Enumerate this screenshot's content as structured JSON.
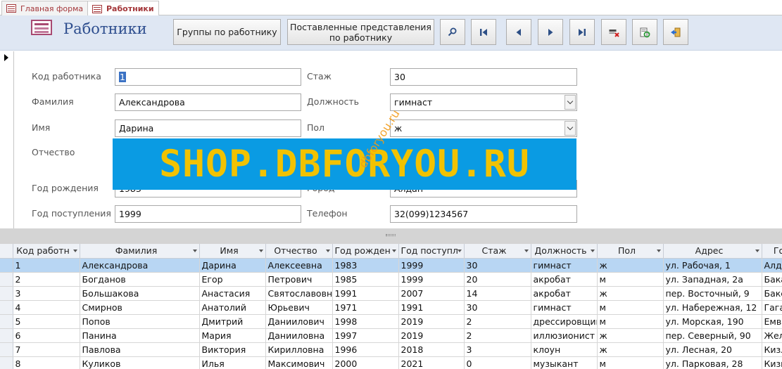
{
  "tabs": [
    {
      "label": "Главная форма",
      "active": false
    },
    {
      "label": "Работники",
      "active": true
    }
  ],
  "header": {
    "title": "Работники",
    "btn_groups": "Группы по работнику",
    "btn_performances_l1": "Поставленные представления",
    "btn_performances_l2": "по работнику"
  },
  "icons": {
    "search": "magnifier-icon",
    "first": "first-record-icon",
    "prev": "previous-record-icon",
    "next": "next-record-icon",
    "last": "last-record-icon",
    "delete": "delete-record-icon",
    "refresh": "refresh-icon",
    "exit": "exit-icon"
  },
  "form": {
    "code_label": "Код работника",
    "code_value": "1",
    "surname_label": "Фамилия",
    "surname_value": "Александрова",
    "name_label": "Имя",
    "name_value": "Дарина",
    "patronymic_label": "Отчество",
    "birth_label": "Год рождения",
    "birth_value": "1983",
    "hire_label": "Год поступления",
    "hire_value": "1999",
    "exp_label": "Стаж",
    "exp_value": "30",
    "position_label": "Должность",
    "position_value": "гимнаст",
    "sex_label": "Пол",
    "sex_value": "ж",
    "city_label": "Город",
    "city_value": "Алдан",
    "phone_label": "Телефон",
    "phone_value": "32(099)1234567"
  },
  "watermark": {
    "banner": "SHOP.DBFORYOU.RU",
    "diagonal": "dbforyou.ru"
  },
  "grid": {
    "columns": [
      "Код работн",
      "Фамилия",
      "Имя",
      "Отчество",
      "Год рожден",
      "Год поступл",
      "Стаж",
      "Должность",
      "Пол",
      "Адрес",
      "Го"
    ],
    "rows": [
      [
        "1",
        "Александрова",
        "Дарина",
        "Алексеевна",
        "1983",
        "1999",
        "30",
        "гимнаст",
        "ж",
        "ул. Рабочая, 1",
        "Алда"
      ],
      [
        "2",
        "Богданов",
        "Егор",
        "Петрович",
        "1985",
        "1999",
        "20",
        "акробат",
        "м",
        "ул. Западная, 2а",
        "Бака"
      ],
      [
        "3",
        "Большакова",
        "Анастасия",
        "Святославовна",
        "1991",
        "2007",
        "14",
        "акробат",
        "ж",
        "пер. Восточный, 9",
        "Бакс"
      ],
      [
        "4",
        "Смирнов",
        "Анатолий",
        "Юрьевич",
        "1971",
        "1991",
        "30",
        "гимнаст",
        "м",
        "ул. Набережная, 12",
        "Гага"
      ],
      [
        "5",
        "Попов",
        "Дмитрий",
        "Даниилович",
        "1998",
        "2019",
        "2",
        "дрессировщик",
        "м",
        "ул. Морская, 190",
        "Емва"
      ],
      [
        "6",
        "Панина",
        "Мария",
        "Данииловна",
        "1997",
        "2019",
        "2",
        "иллюзионист",
        "ж",
        "пер. Северный, 90",
        "Жел"
      ],
      [
        "7",
        "Павлова",
        "Виктория",
        "Кирилловна",
        "1996",
        "2018",
        "3",
        "клоун",
        "ж",
        "ул. Лесная, 20",
        "Кизл"
      ],
      [
        "8",
        "Куликов",
        "Илья",
        "Максимович",
        "2000",
        "2021",
        "0",
        "музыкант",
        "м",
        "ул. Парковая, 28",
        "Кизн"
      ]
    ]
  }
}
